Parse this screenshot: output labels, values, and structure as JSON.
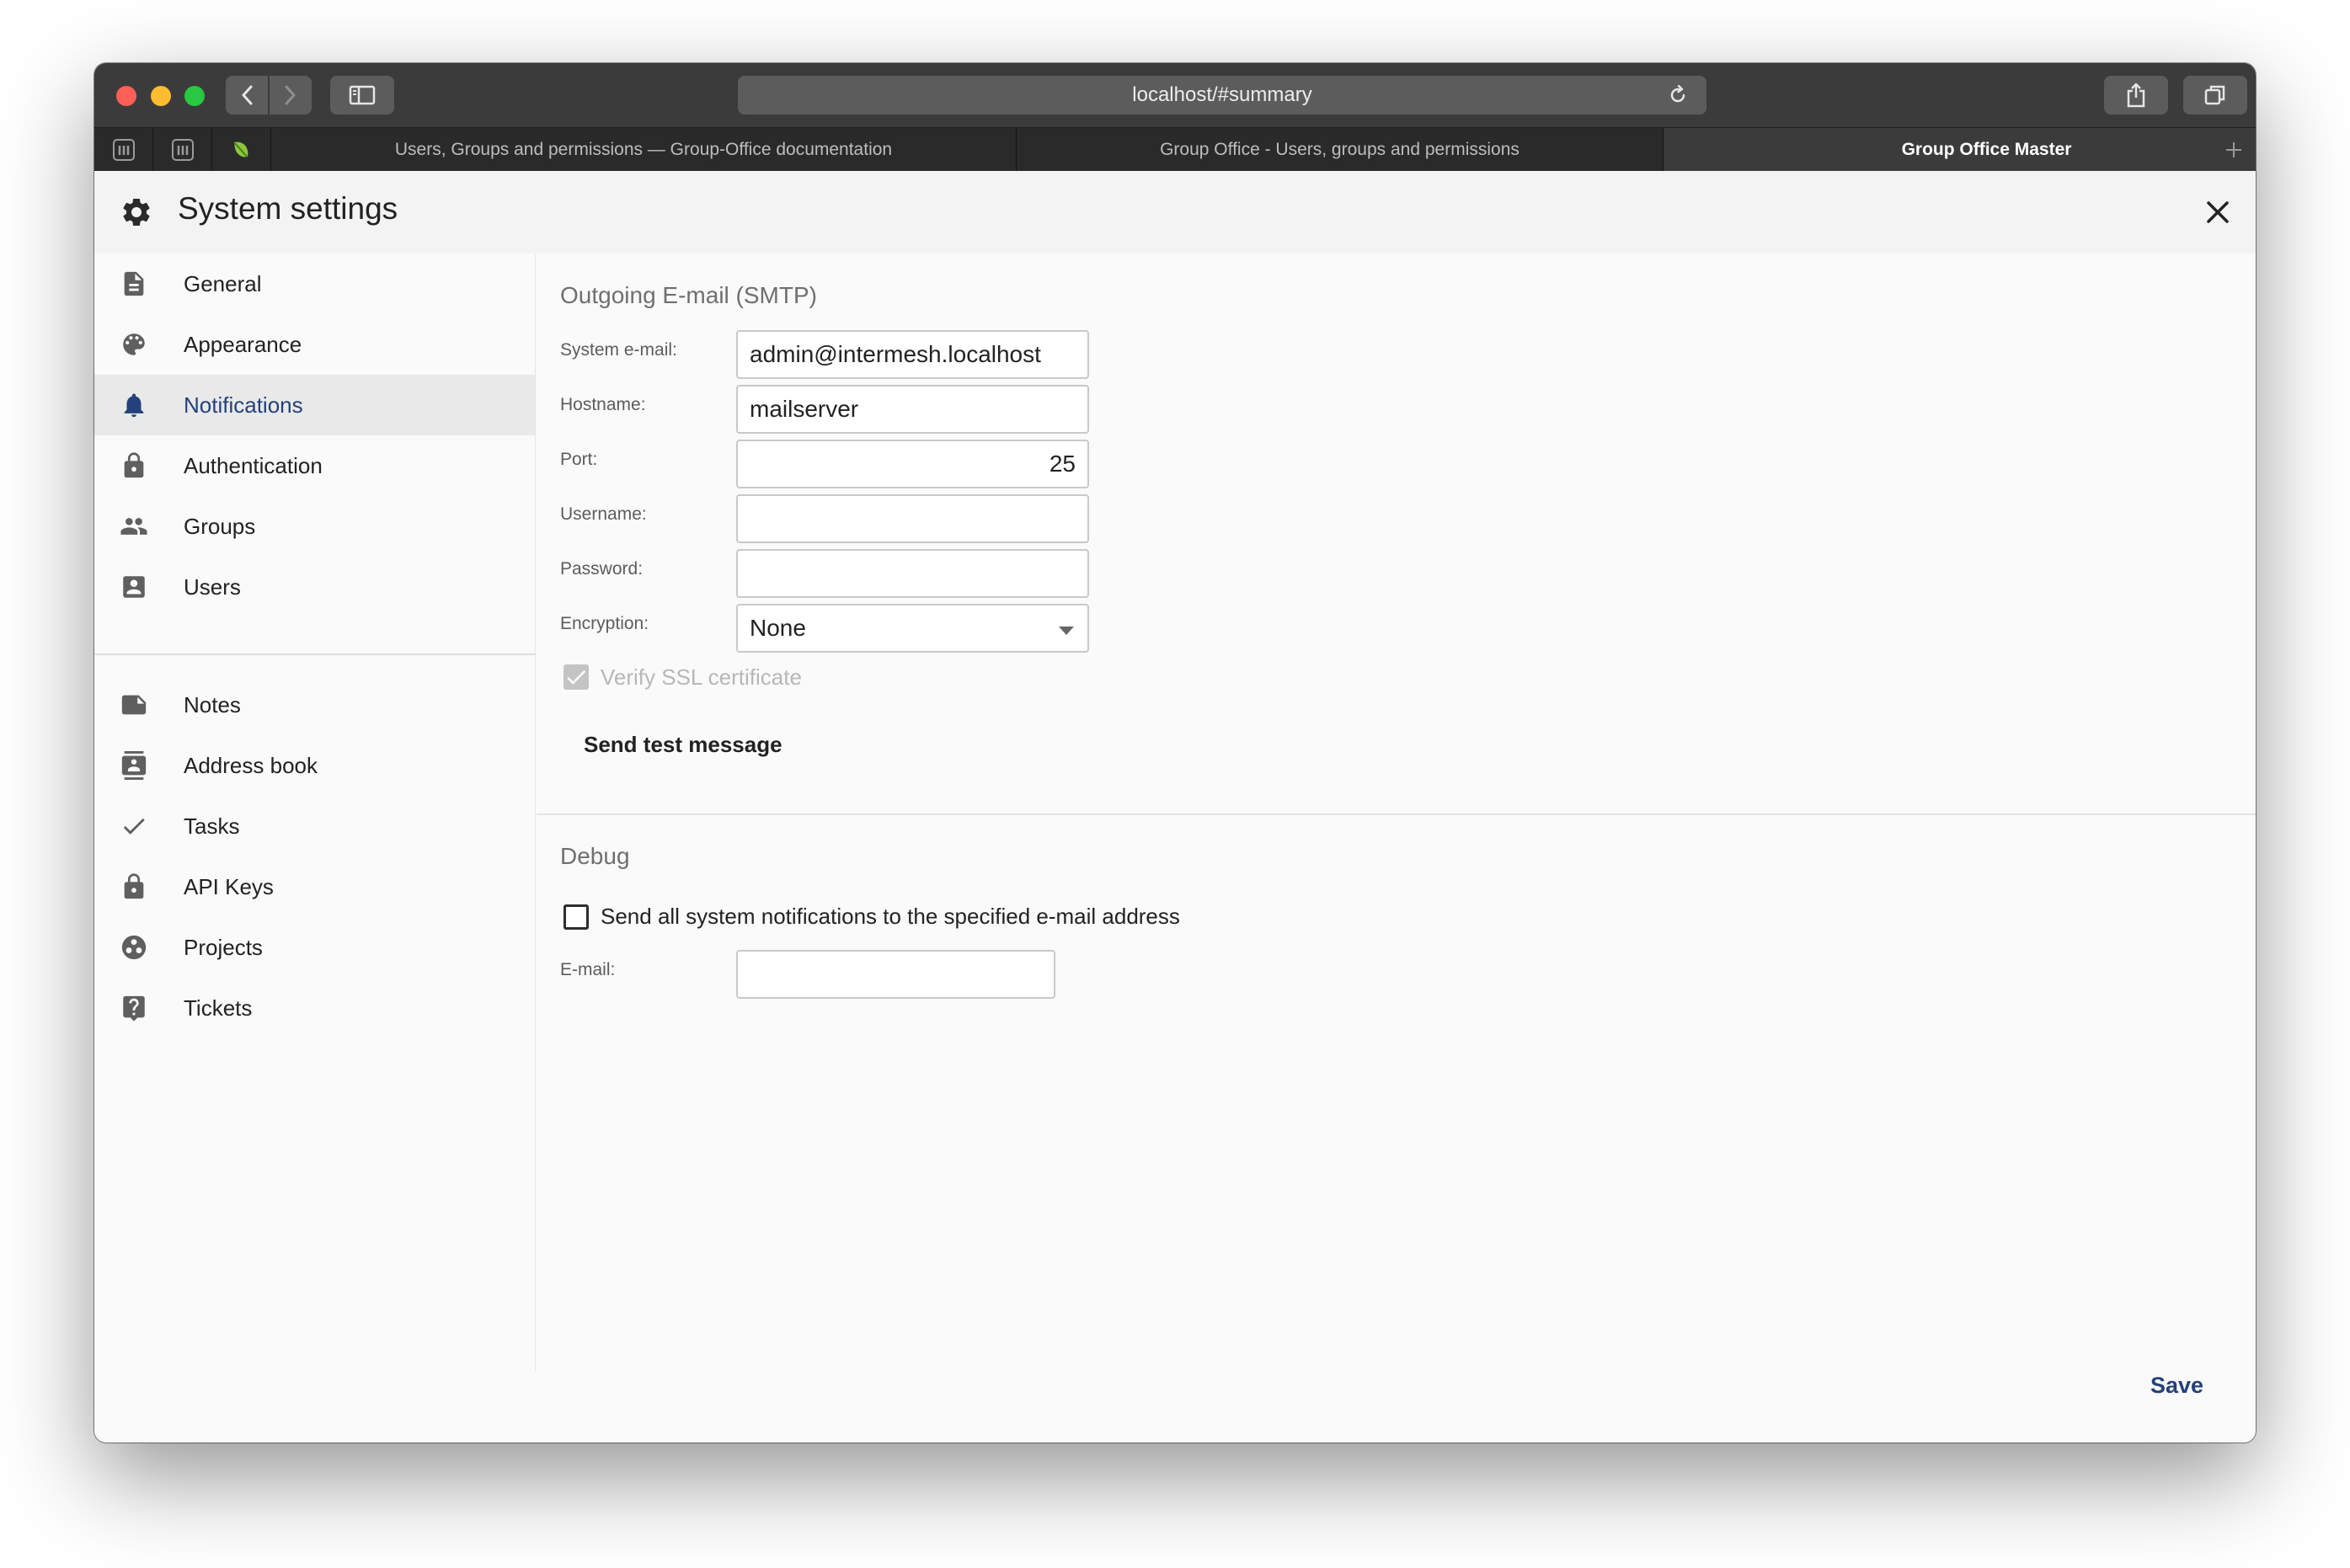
{
  "browser": {
    "url": "localhost/#summary",
    "tabs": [
      {
        "title": "Users, Groups and permissions — Group-Office documentation",
        "active": false
      },
      {
        "title": "Group Office - Users, groups and permissions",
        "active": false
      },
      {
        "title": "Group Office Master",
        "active": true
      }
    ]
  },
  "dialog": {
    "title": "System settings"
  },
  "sidebar": {
    "items": [
      {
        "label": "General",
        "icon": "document-icon"
      },
      {
        "label": "Appearance",
        "icon": "palette-icon"
      },
      {
        "label": "Notifications",
        "icon": "bell-icon",
        "active": true
      },
      {
        "label": "Authentication",
        "icon": "lock-icon"
      },
      {
        "label": "Groups",
        "icon": "group-icon"
      },
      {
        "label": "Users",
        "icon": "user-icon"
      },
      {
        "label": "Notes",
        "icon": "note-icon"
      },
      {
        "label": "Address book",
        "icon": "address-book-icon"
      },
      {
        "label": "Tasks",
        "icon": "check-icon"
      },
      {
        "label": "API Keys",
        "icon": "lock-icon"
      },
      {
        "label": "Projects",
        "icon": "projects-icon"
      },
      {
        "label": "Tickets",
        "icon": "help-icon"
      }
    ]
  },
  "smtp": {
    "title": "Outgoing E-mail (SMTP)",
    "system_email_label": "System e-mail:",
    "system_email": "admin@intermesh.localhost",
    "hostname_label": "Hostname:",
    "hostname": "mailserver",
    "port_label": "Port:",
    "port": "25",
    "username_label": "Username:",
    "username": "",
    "password_label": "Password:",
    "password": "",
    "encryption_label": "Encryption:",
    "encryption": "None",
    "verify_ssl_label": "Verify SSL certificate",
    "verify_ssl_checked": true,
    "test_button": "Send test message"
  },
  "debug": {
    "title": "Debug",
    "send_all_label": "Send all system notifications to the specified e-mail address",
    "send_all_checked": false,
    "email_label": "E-mail:",
    "email": ""
  },
  "footer": {
    "save_label": "Save"
  },
  "colors": {
    "accent": "#23417a",
    "active_nav_bg": "#e9e9e9"
  }
}
